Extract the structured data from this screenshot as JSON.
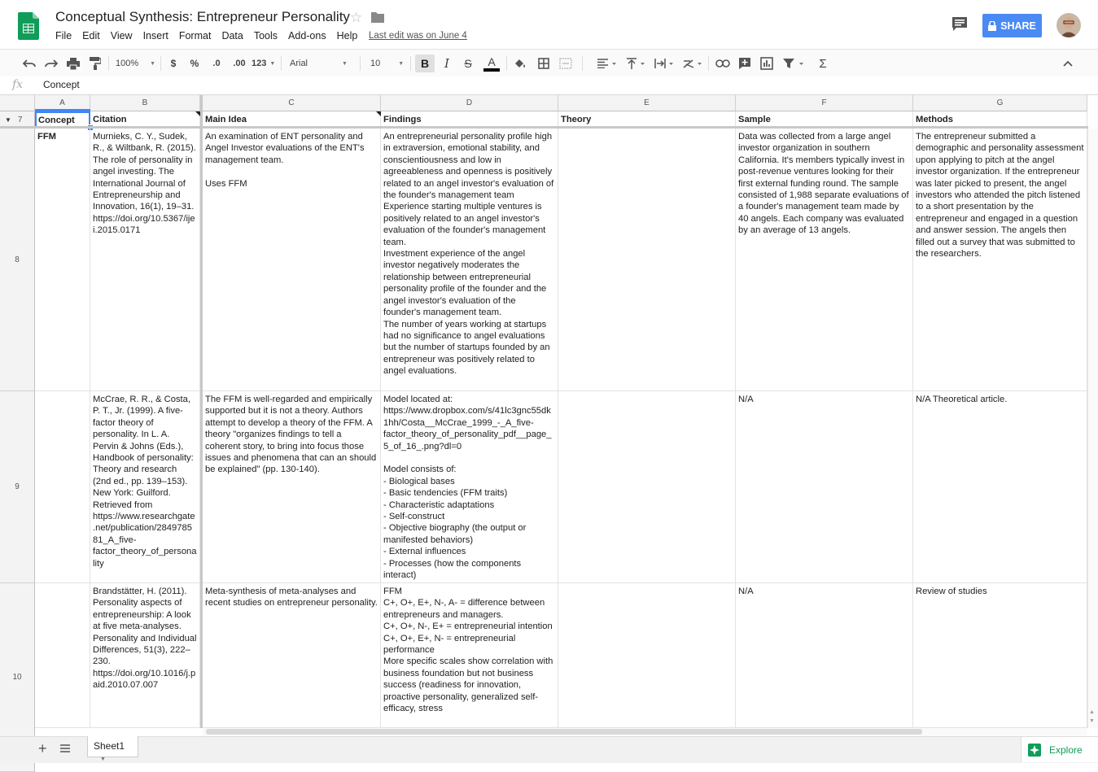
{
  "header": {
    "title": "Conceptual Synthesis: Entrepreneur Personality",
    "menu": [
      "File",
      "Edit",
      "View",
      "Insert",
      "Format",
      "Data",
      "Tools",
      "Add-ons",
      "Help"
    ],
    "last_edit": "Last edit was on June 4",
    "share_label": "SHARE"
  },
  "toolbar": {
    "zoom": "100%",
    "currency": "$",
    "percent": "%",
    "dec_less": ".0",
    "dec_more": ".00",
    "more_formats": "123",
    "font": "Arial",
    "font_size": "10"
  },
  "formula": {
    "fx": "fx",
    "value": "Concept"
  },
  "columns": [
    "A",
    "B",
    "C",
    "D",
    "E",
    "F",
    "G"
  ],
  "row_numbers": [
    "7",
    "8",
    "9",
    "10"
  ],
  "header_row": [
    "Concept",
    "Citation",
    "Main Idea",
    "Findings",
    "Theory",
    "Sample",
    "Methods"
  ],
  "rows": [
    {
      "concept": "FFM",
      "citation": "Murnieks, C. Y., Sudek, R., & Wiltbank, R. (2015). The role of personality in angel investing. The International Journal of Entrepreneurship and Innovation, 16(1), 19–31. https://doi.org/10.5367/ijei.2015.0171",
      "main_idea": "An examination of ENT personality and Angel Investor evaluations of the ENT's management team.\n\nUses FFM",
      "findings": "An entrepreneurial personality profile high in extraversion, emotional stability, and conscientiousness and low in agreeableness and openness is positively related to an angel investor's evaluation of the founder's management team\nExperience starting multiple ventures is positively related to an angel investor's evaluation of the founder's management team.\nInvestment experience of the angel investor negatively moderates the relationship between entrepreneurial personality profile of the founder and the angel investor's evaluation of the founder's management team.\nThe number of years working at startups had no significance to angel evaluations but the number of startups founded by an entrepreneur was positively related to angel evaluations.",
      "theory": "",
      "sample": "Data was collected from a large angel investor organization in southern California. It's members typically invest in post-revenue ventures looking for their first external funding round. The sample consisted of 1,988 separate evaluations of a founder's management team made by 40 angels. Each company was evaluated by an average of 13 angels.",
      "methods": "The entrepreneur submitted a demographic and personality assessment upon applying to pitch at the angel investor organization. If the entrepreneur was later picked to present, the angel investors who attended the pitch listened to a short presentation by the entrepreneur and engaged in a question and answer session. The angels then filled out a survey that was submitted to the researchers."
    },
    {
      "concept": "",
      "citation": "McCrae, R. R., & Costa, P. T., Jr. (1999). A five-factor theory of personality. In L. A. Pervin & Johns (Eds.), Handbook of personality: Theory and research (2nd ed., pp. 139–153). New York: Guilford. Retrieved from https://www.researchgate.net/publication/284978581_A_five-factor_theory_of_personality",
      "main_idea": "The FFM is well-regarded and empirically supported but it is not a theory. Authors attempt to develop a theory of the FFM. A theory \"organizes findings to tell a coherent story, to bring into focus those issues and phenomena that can an should be explained\" (pp. 130-140).",
      "findings": "Model located at:\nhttps://www.dropbox.com/s/41lc3gnc55dk1hh/Costa__McCrae_1999_-_A_five-factor_theory_of_personality_pdf__page_5_of_16_.png?dl=0\n\nModel consists of:\n- Biological bases\n- Basic tendencies (FFM traits)\n- Characteristic adaptations\n- Self-construct\n- Objective biography (the output or manifested behaviors)\n- External influences\n- Processes (how the components interact)",
      "theory": "",
      "sample": "N/A",
      "methods": "N/A Theoretical article."
    },
    {
      "concept": "",
      "citation": "Brandstätter, H. (2011). Personality aspects of entrepreneurship: A look at five meta-analyses. Personality and Individual Differences, 51(3), 222–230. https://doi.org/10.1016/j.paid.2010.07.007",
      "main_idea": "Meta-synthesis of meta-analyses and recent studies on entrepreneur personality.",
      "findings": "FFM\nC+, O+, E+, N-, A- = difference between entrepreneurs and managers.\nC+, O+, N-, E+ = entrepreneurial intention\nC+, O+, E+, N- = entrepreneurial performance\nMore specific scales show correlation with business foundation but not business success (readiness for innovation, proactive personality, generalized self-efficacy, stress",
      "theory": "",
      "sample": "N/A",
      "methods": "Review of studies"
    }
  ],
  "bottom": {
    "sheet_name": "Sheet1",
    "explore_label": "Explore"
  },
  "colors": {
    "share_blue": "#4a8af4",
    "sheets_green": "#0f9d58",
    "selection_blue": "#4285f4"
  }
}
